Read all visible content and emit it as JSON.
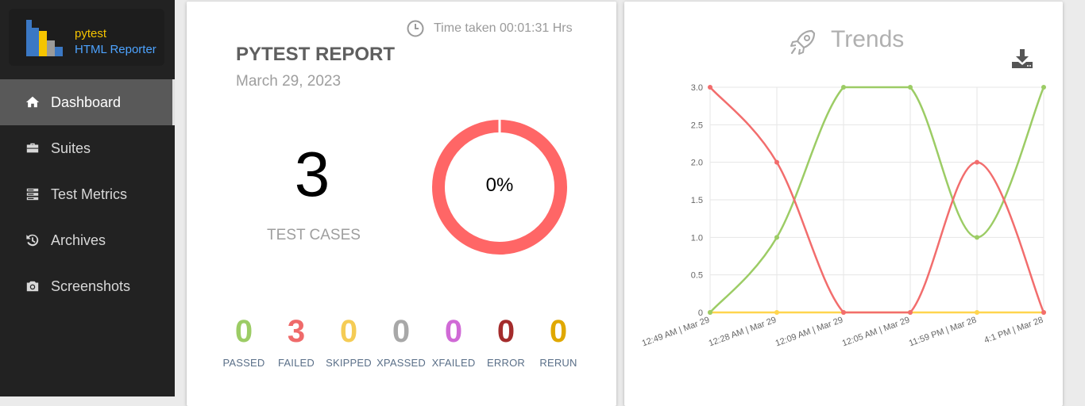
{
  "sidebar": {
    "logo_line1": "pytest",
    "logo_line2": "HTML Reporter",
    "items": [
      {
        "label": "Dashboard",
        "icon": "home-icon",
        "active": true
      },
      {
        "label": "Suites",
        "icon": "briefcase-icon",
        "active": false
      },
      {
        "label": "Test Metrics",
        "icon": "server-icon",
        "active": false
      },
      {
        "label": "Archives",
        "icon": "history-icon",
        "active": false
      },
      {
        "label": "Screenshots",
        "icon": "camera-icon",
        "active": false
      }
    ]
  },
  "report": {
    "time_taken": "Time taken 00:01:31 Hrs",
    "title": "PYTEST REPORT",
    "date": "March 29, 2023",
    "total": "3",
    "total_label": "TEST CASES",
    "pass_percent": "0%",
    "pass_fraction": 0
  },
  "stats": [
    {
      "value": "0",
      "label": "PASSED",
      "color": "#9ccc65"
    },
    {
      "value": "3",
      "label": "FAILED",
      "color": "#ef6a6a"
    },
    {
      "value": "0",
      "label": "SKIPPED",
      "color": "#f5cc55"
    },
    {
      "value": "0",
      "label": "XPASSED",
      "color": "#a8a8a8"
    },
    {
      "value": "0",
      "label": "XFAILED",
      "color": "#d06ad6"
    },
    {
      "value": "0",
      "label": "ERROR",
      "color": "#a42c2c"
    },
    {
      "value": "0",
      "label": "RERUN",
      "color": "#e0a800"
    }
  ],
  "trends": {
    "title": "Trends"
  },
  "colors": {
    "failed": "#f26d6d",
    "passed": "#9ccc65",
    "skipped": "#ffd54f"
  },
  "chart_data": {
    "type": "line",
    "categories": [
      "12:49 AM | Mar 29",
      "12:28 AM | Mar 29",
      "12:09 AM | Mar 29",
      "12:05 AM | Mar 29",
      "11:59 PM | Mar 28",
      "4:1 PM | Mar 28"
    ],
    "series": [
      {
        "values": [
          3,
          2,
          0,
          0,
          2,
          0
        ],
        "color": "#f26d6d"
      },
      {
        "values": [
          0,
          1,
          3,
          3,
          1,
          3
        ],
        "color": "#9ccc65"
      },
      {
        "values": [
          0,
          0,
          0,
          0,
          0,
          0
        ],
        "color": "#ffd54f"
      }
    ],
    "yticks": [
      "0",
      "0.5",
      "1.0",
      "1.5",
      "2.0",
      "2.5",
      "3.0"
    ],
    "ylim": [
      0,
      3
    ],
    "grid": true
  }
}
